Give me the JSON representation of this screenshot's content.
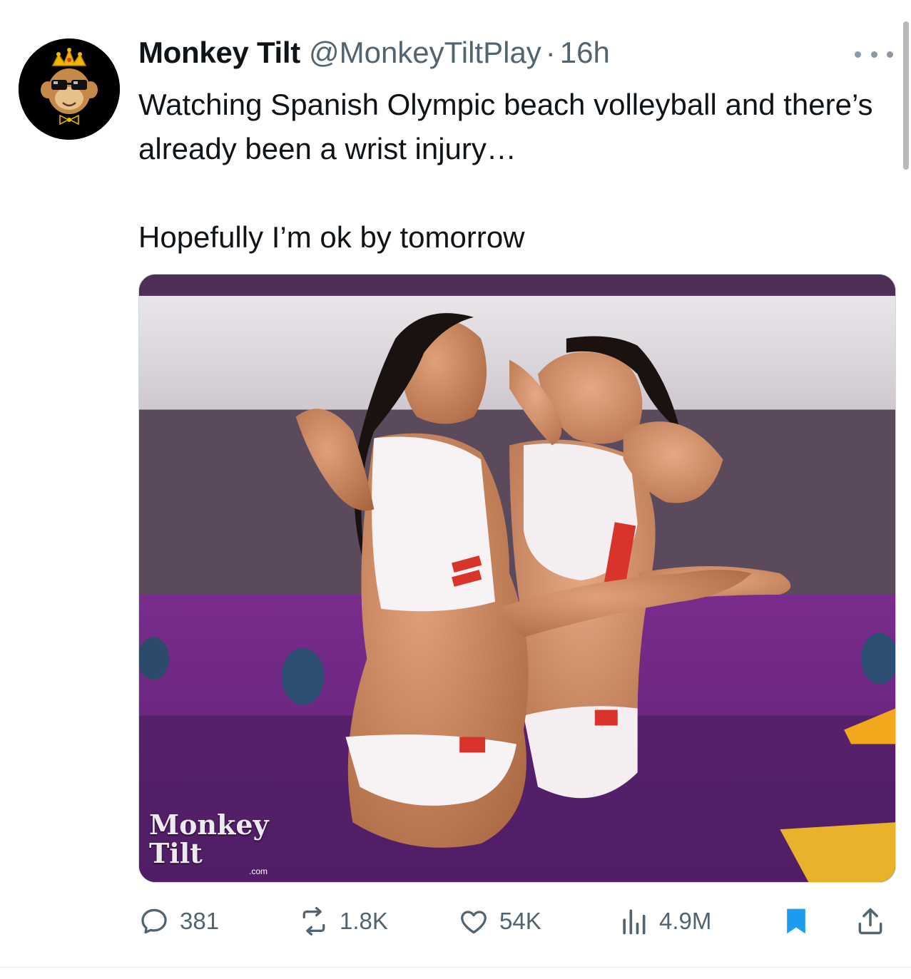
{
  "author": {
    "display_name": "Monkey Tilt",
    "handle": "@MonkeyTiltPlay",
    "separator": "·",
    "time": "16h"
  },
  "tweet": {
    "text_line_1": "Watching Spanish Olympic beach volleyball and there’s already been a wrist injury…",
    "text_line_2": "Hopefully I’m ok by tomorrow"
  },
  "media": {
    "watermark_text": "Monkey Tilt",
    "watermark_sub": ".com"
  },
  "actions": {
    "replies": "381",
    "reposts": "1.8K",
    "likes": "54K",
    "views": "4.9M"
  },
  "colors": {
    "text_primary": "#0f1419",
    "text_secondary": "#536471",
    "bookmark_active": "#1d9bf0",
    "crown_gold": "#f2b705"
  },
  "icons": {
    "reply": "reply-icon",
    "repost": "repost-icon",
    "like": "heart-icon",
    "views": "views-icon",
    "bookmark": "bookmark-icon",
    "share": "share-icon",
    "more": "more-icon"
  }
}
